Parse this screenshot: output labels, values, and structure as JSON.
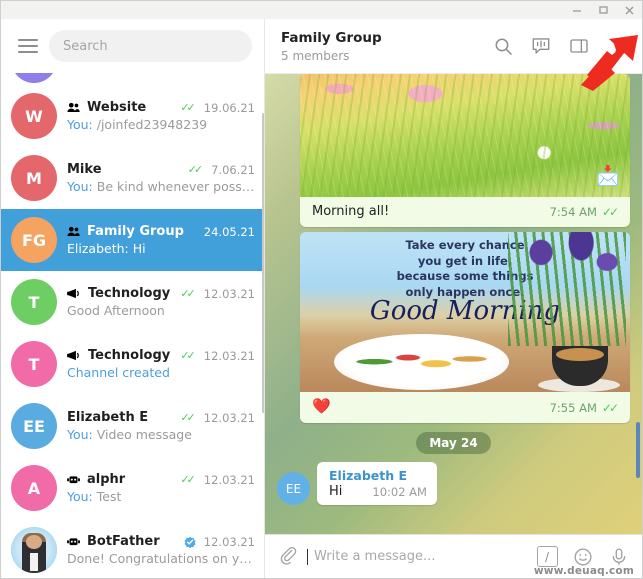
{
  "window": {
    "minimize_label": "–",
    "maximize_label": "☐",
    "close_label": "✕"
  },
  "sidebar": {
    "menu_icon": "hamburger-icon",
    "search": {
      "placeholder": "Search"
    },
    "chats": [
      {
        "title": "Website",
        "initials": "W",
        "avatar_color": "#e4676b",
        "date": "19.06.21",
        "ticks": true,
        "badge": "group-icon",
        "prefix": "You:",
        "preview": " /joinfed23948239",
        "active": false
      },
      {
        "title": "Mike",
        "initials": "M",
        "avatar_color": "#e4676b",
        "date": "7.06.21",
        "ticks": true,
        "badge": "",
        "prefix": "You:",
        "preview": " Be kind whenever possi...",
        "active": false
      },
      {
        "title": "Family Group",
        "initials": "FG",
        "avatar_color": "#f5a361",
        "date": "24.05.21",
        "ticks": false,
        "badge": "group-icon",
        "prefix": "",
        "preview": "Elizabeth: Hi",
        "active": true
      },
      {
        "title": "Technology",
        "initials": "T",
        "avatar_color": "#6ece63",
        "date": "12.03.21",
        "ticks": true,
        "badge": "channel-icon",
        "prefix": "",
        "preview": "Good Afternoon",
        "active": false
      },
      {
        "title": "Technology",
        "initials": "T",
        "avatar_color": "#f06ba8",
        "date": "12.03.21",
        "ticks": true,
        "badge": "channel-icon",
        "prefix": "",
        "preview": "Channel created",
        "preview_blue": true,
        "active": false
      },
      {
        "title": "Elizabeth E",
        "initials": "EE",
        "avatar_color": "#5aabe0",
        "date": "12.03.21",
        "ticks": true,
        "badge": "",
        "prefix": "You:",
        "preview": " Video message",
        "preview_blue": true,
        "active": false
      },
      {
        "title": "alphr",
        "initials": "A",
        "avatar_color": "#f06ba8",
        "date": "12.03.21",
        "ticks": true,
        "badge": "bot-icon",
        "prefix": "You:",
        "preview": " Test",
        "active": false
      },
      {
        "title": "BotFather",
        "initials": "",
        "avatar_color": "#7fc4e8",
        "date": "12.03.21",
        "ticks": false,
        "badge": "bot-icon",
        "verified": true,
        "photo_avatar": true,
        "prefix": "",
        "preview": "Done! Congratulations on yo...",
        "active": false
      }
    ]
  },
  "chat": {
    "header": {
      "title": "Family Group",
      "subtitle": "5 members",
      "icons": [
        {
          "name": "search-icon"
        },
        {
          "name": "voice-chat-icon"
        },
        {
          "name": "toggle-info-panel-icon"
        },
        {
          "name": "more-options-icon"
        }
      ]
    },
    "messages": [
      {
        "type": "outgoing-photo",
        "art": "meadow",
        "caption": "Morning all!",
        "time": "7:54 AM",
        "ticks": true,
        "reaction": ""
      },
      {
        "type": "outgoing-photo",
        "art": "good-morning",
        "quote_lines": [
          "Take every chance",
          "you get in life,",
          "because some things",
          "only happen once."
        ],
        "headline": "Good Morning",
        "caption": "",
        "reaction": "❤️",
        "time": "7:55 AM",
        "ticks": true
      },
      {
        "type": "date-separator",
        "label": "May 24"
      },
      {
        "type": "incoming",
        "avatar_initials": "EE",
        "sender": "Elizabeth E",
        "text": "Hi",
        "time": "10:02 AM"
      }
    ]
  },
  "composer": {
    "attach_icon": "paperclip-icon",
    "placeholder": "Write a message...",
    "value": "",
    "icons": [
      {
        "name": "command-slash-icon",
        "glyph": "/"
      },
      {
        "name": "emoji-icon"
      },
      {
        "name": "microphone-icon"
      }
    ]
  },
  "annotation": {
    "arrow_color": "#ee2b21",
    "points_to": "more-options-icon"
  },
  "watermark": {
    "text": "www.deuaq.com"
  }
}
